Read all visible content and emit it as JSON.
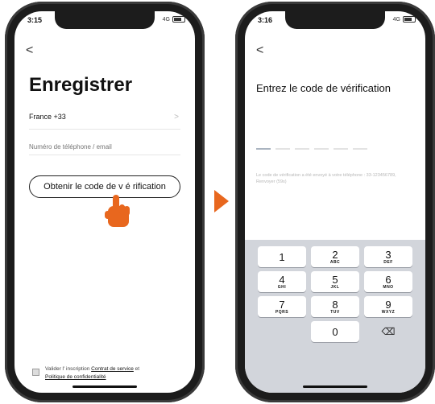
{
  "left_screen": {
    "status_time": "3:15",
    "status_network": "4G",
    "back_glyph": "<",
    "title": "Enregistrer",
    "country": "France +33",
    "country_chevron": ">",
    "phone_placeholder": "Numéro de téléphone / email",
    "button_label": "Obtenir le code de v é rification",
    "terms_prefix": "Valider l' inscription ",
    "terms_link1": "Contrat de service",
    "terms_mid": " et",
    "terms_link2": "Politique de confidentialité"
  },
  "right_screen": {
    "status_time": "3:16",
    "status_network": "4G",
    "back_glyph": "<",
    "title": "Entrez le code de vérification",
    "hint": "Le code de vérification a été envoyé à votre téléphone : 33-123456789, Renvoyer (59s)",
    "keypad": [
      [
        {
          "digit": "1",
          "sub": ""
        },
        {
          "digit": "2",
          "sub": "ABC"
        },
        {
          "digit": "3",
          "sub": "DEF"
        }
      ],
      [
        {
          "digit": "4",
          "sub": "GHI"
        },
        {
          "digit": "5",
          "sub": "JKL"
        },
        {
          "digit": "6",
          "sub": "MNO"
        }
      ],
      [
        {
          "digit": "7",
          "sub": "PQRS"
        },
        {
          "digit": "8",
          "sub": "TUV"
        },
        {
          "digit": "9",
          "sub": "WXYZ"
        }
      ],
      [
        {
          "digit": "",
          "sub": ""
        },
        {
          "digit": "0",
          "sub": ""
        },
        {
          "digit": "⌫",
          "sub": ""
        }
      ]
    ]
  },
  "colors": {
    "arrow": "#e8671e",
    "hand": "#e8671e"
  },
  "icons": {
    "arrow": "right-triangle-icon",
    "pointer": "pointing-hand-icon",
    "delete": "backspace-icon"
  }
}
